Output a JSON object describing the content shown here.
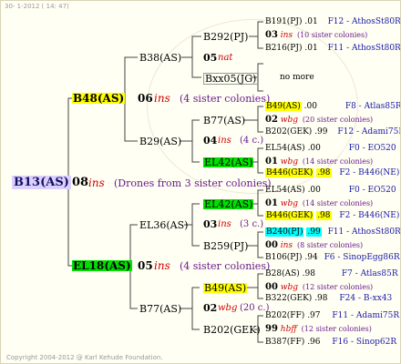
{
  "header": {
    "date": "30-  1-2012 ( 14: 47)"
  },
  "footer": {
    "copyright": "Copyright 2004-2012 @ Karl Kehude Foundation."
  },
  "gen0": {
    "name": "B13(AS)",
    "year": "08",
    "ins": "ins",
    "note": "(Drones from 3 sister colonies)"
  },
  "gen1": {
    "upper": {
      "name": "B48(AS)",
      "year": "06",
      "ins": "ins",
      "note": "(4 sister colonies)"
    },
    "lower": {
      "name": "EL18(AS)",
      "year": "05",
      "ins": "ins",
      "note": "(4 sister colonies)"
    }
  },
  "gen2": {
    "b38": {
      "name": "B38(AS)",
      "year": "05",
      "ins": "nat"
    },
    "b29": {
      "name": "B29(AS)",
      "year": "04",
      "ins": "ins",
      "note": "(4 c.)"
    },
    "el36": {
      "name": "EL36(AS)",
      "year": "03",
      "ins": "ins",
      "note": "(3 c.)"
    },
    "b77": {
      "name": "B77(AS)",
      "year": "02",
      "ins": "wbg",
      "note": "(20 c.)"
    }
  },
  "gen3": {
    "b292": {
      "name": "B292(PJ)"
    },
    "bxx05": {
      "name": "Bxx05(JG)"
    },
    "b77a": {
      "name": "B77(AS)"
    },
    "el42a": {
      "name": "EL42(AS)"
    },
    "el42b": {
      "name": "EL42(AS)"
    },
    "b259": {
      "name": "B259(PJ)"
    },
    "b49": {
      "name": "B49(AS)"
    },
    "b202": {
      "name": "B202(GEK)"
    }
  },
  "gen4": {
    "r1": {
      "name": "B191(PJ)",
      "val": ".01",
      "line": "F12 - AthosSt80R"
    },
    "r2": {
      "year": "03",
      "ins": "ins",
      "note": "(10 sister colonies)"
    },
    "r3": {
      "name": "B216(PJ)",
      "val": ".01",
      "line": "F11 - AthosSt80R"
    },
    "r4": {
      "text": "no more"
    },
    "r5": {
      "name": "B49(AS)",
      "val": ".00",
      "line": "F8 - Atlas85R"
    },
    "r6": {
      "year": "02",
      "ins": "wbg",
      "note": "(20 sister colonies)"
    },
    "r7": {
      "name": "B202(GEK)",
      "val": ".99",
      "line": "F12 - Adami75R"
    },
    "r8": {
      "name": "EL54(AS)",
      "val": ".00",
      "line": "F0 - EO520"
    },
    "r9": {
      "year": "01",
      "ins": "wbg",
      "note": "(14 sister colonies)"
    },
    "r10": {
      "name": "B446(GEK)",
      "val": ".98",
      "line": "F2 - B446(NE)"
    },
    "r11": {
      "name": "EL54(AS)",
      "val": ".00",
      "line": "F0 - EO520"
    },
    "r12": {
      "year": "01",
      "ins": "wbg",
      "note": "(14 sister colonies)"
    },
    "r13": {
      "name": "B446(GEK)",
      "val": ".98",
      "line": "F2 - B446(NE)"
    },
    "r14": {
      "name": "B240(PJ)",
      "val": ".99",
      "line": "F11 - AthosSt80R"
    },
    "r15": {
      "year": "00",
      "ins": "ins",
      "note": "(8 sister colonies)"
    },
    "r16": {
      "name": "B106(PJ)",
      "val": ".94",
      "line": "F6 - SinopEgg86R"
    },
    "r17": {
      "name": "B28(AS)",
      "val": ".98",
      "line": "F7 - Atlas85R"
    },
    "r18": {
      "year": "00",
      "ins": "wbg",
      "note": "(12 sister colonies)"
    },
    "r19": {
      "name": "B322(GEK)",
      "val": ".98",
      "line": "F24 - B-xx43"
    },
    "r20": {
      "name": "B202(FF)",
      "val": ".97",
      "line": "F11 - Adami75R"
    },
    "r21": {
      "year": "99",
      "ins": "hbff",
      "note": "(12 sister colonies)"
    },
    "r22": {
      "name": "B387(FF)",
      "val": ".96",
      "line": "F16 - Sinop62R"
    }
  }
}
